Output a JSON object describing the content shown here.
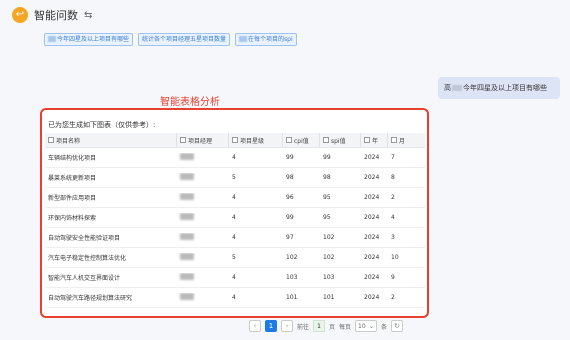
{
  "header": {
    "title": "智能问数",
    "logo_glyph": "↩",
    "switch_glyph": "⇆"
  },
  "suggestions": [
    {
      "redacted_prefix": true,
      "text": "今年四星及以上项目有哪些"
    },
    {
      "redacted_prefix": false,
      "text": "统计各个项目经理五星项目数量"
    },
    {
      "redacted_prefix": true,
      "text": "在每个项目的spi"
    }
  ],
  "user_message": {
    "prefix": "高",
    "text": "今年四星及以上项目有哪些"
  },
  "annotation": "智能表格分析",
  "answer": {
    "intro": "已为您生成如下图表（仅供参考）:",
    "columns": [
      "项目名称",
      "项目经理",
      "项目星级",
      "cpi值",
      "spi值",
      "年",
      "月"
    ],
    "rows": [
      {
        "name": "车辆结构优化项目",
        "stars": "4",
        "cpi": "99",
        "spi": "99",
        "year": "2024",
        "month": "7"
      },
      {
        "name": "暴莱系统更新项目",
        "stars": "5",
        "cpi": "98",
        "spi": "98",
        "year": "2024",
        "month": "8"
      },
      {
        "name": "新型部件应用项目",
        "stars": "4",
        "cpi": "96",
        "spi": "95",
        "year": "2024",
        "month": "2"
      },
      {
        "name": "环保内饰材料探索",
        "stars": "4",
        "cpi": "99",
        "spi": "95",
        "year": "2024",
        "month": "4"
      },
      {
        "name": "自动驾驶安全性能验证项目",
        "stars": "4",
        "cpi": "97",
        "spi": "102",
        "year": "2024",
        "month": "3"
      },
      {
        "name": "汽车电子稳定性控制算法优化",
        "stars": "5",
        "cpi": "102",
        "spi": "102",
        "year": "2024",
        "month": "10"
      },
      {
        "name": "智能汽车人机交互界面设计",
        "stars": "4",
        "cpi": "103",
        "spi": "103",
        "year": "2024",
        "month": "9"
      },
      {
        "name": "自动驾驶汽车路径规划算法研究",
        "stars": "4",
        "cpi": "101",
        "spi": "101",
        "year": "2024",
        "month": "2"
      }
    ]
  },
  "pagination": {
    "prev": "‹",
    "current_page": "1",
    "next": "›",
    "goto_label": "前往",
    "goto_value": "1",
    "page_unit": "页",
    "per_page_label": "每页",
    "per_page_value": "10",
    "per_page_unit": "条",
    "refresh": "↻"
  },
  "colors": {
    "accent": "#1e7be6",
    "highlight_border": "#e8402f",
    "logo": "#f5a524",
    "chip_border": "#9ec3f0",
    "user_bubble": "#dce4f6"
  }
}
